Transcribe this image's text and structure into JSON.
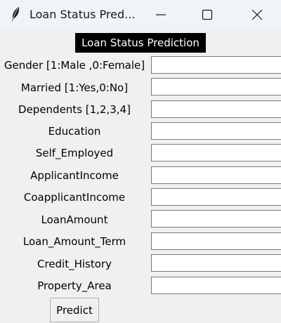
{
  "window": {
    "title": "Loan Status Pred...",
    "app_icon": "feather-icon",
    "controls": [
      "minimize-icon",
      "maximize-icon",
      "close-icon"
    ]
  },
  "heading": "Loan Status Prediction",
  "fields": [
    {
      "label": "Gender [1:Male ,0:Female]",
      "value": ""
    },
    {
      "label": "Married [1:Yes,0:No]",
      "value": ""
    },
    {
      "label": "Dependents [1,2,3,4]",
      "value": ""
    },
    {
      "label": "Education",
      "value": ""
    },
    {
      "label": "Self_Employed",
      "value": ""
    },
    {
      "label": "ApplicantIncome",
      "value": ""
    },
    {
      "label": "CoapplicantIncome",
      "value": ""
    },
    {
      "label": "LoanAmount",
      "value": ""
    },
    {
      "label": "Loan_Amount_Term",
      "value": ""
    },
    {
      "label": "Credit_History",
      "value": ""
    },
    {
      "label": "Property_Area",
      "value": ""
    }
  ],
  "predict_button": "Predict",
  "colors": {
    "titlebar_bg": "#eff4f9",
    "window_bg": "#f0f0f0",
    "heading_bg": "#000000",
    "heading_fg": "#ffffff"
  }
}
